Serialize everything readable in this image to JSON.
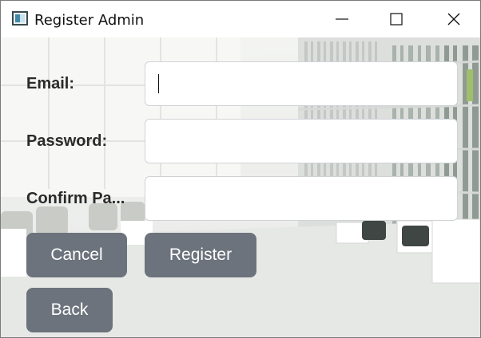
{
  "window": {
    "title": "Register Admin",
    "icon": "app-window-icon",
    "controls": {
      "minimize": "minimize-icon",
      "maximize": "maximize-icon",
      "close": "close-icon"
    }
  },
  "form": {
    "email_label": "Email:",
    "email_value": "",
    "password_label": "Password:",
    "password_value": "",
    "confirm_label": "Confirm Pa...",
    "confirm_value": ""
  },
  "buttons": {
    "cancel": "Cancel",
    "register": "Register",
    "back": "Back"
  },
  "colors": {
    "button_bg": "#6c737c",
    "button_text": "#ffffff",
    "label_text": "#2a2a2a"
  }
}
